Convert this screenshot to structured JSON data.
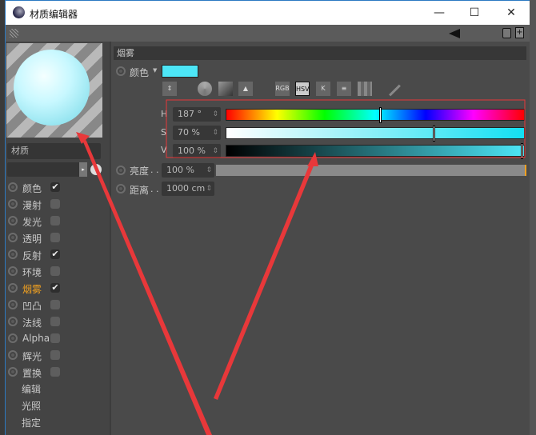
{
  "window": {
    "title": "材质编辑器",
    "minimize": "—",
    "maximize": "☐",
    "close": "✕"
  },
  "left": {
    "material_name_label": "材质",
    "channels": [
      {
        "label": "颜色",
        "checked": true
      },
      {
        "label": "漫射",
        "checked": false
      },
      {
        "label": "发光",
        "checked": false
      },
      {
        "label": "透明",
        "checked": false
      },
      {
        "label": "反射",
        "checked": true
      },
      {
        "label": "环境",
        "checked": false
      },
      {
        "label": "烟雾",
        "checked": true,
        "active": true
      },
      {
        "label": "凹凸",
        "checked": false
      },
      {
        "label": "法线",
        "checked": false
      },
      {
        "label": "Alpha",
        "checked": false
      },
      {
        "label": "辉光",
        "checked": false
      },
      {
        "label": "置换",
        "checked": false
      }
    ],
    "extras": [
      "编辑",
      "光照",
      "指定"
    ]
  },
  "fog": {
    "section_title": "烟雾",
    "color_label": "颜色",
    "color_swatch": "#4de6f7",
    "mode_buttons": [
      "RGB",
      "HSV",
      "K"
    ],
    "active_mode": "HSV",
    "h": {
      "label": "H",
      "value": "187 °",
      "level": 0.52
    },
    "s": {
      "label": "S",
      "value": "70 %",
      "level": 0.7
    },
    "v": {
      "label": "V",
      "value": "100 %",
      "level": 1.0
    },
    "brightness": {
      "label": "亮度",
      "dots": ". .",
      "value": "100 %",
      "level": 1.0
    },
    "distance": {
      "label": "距离",
      "dots": ". .",
      "value": "1000 cm"
    }
  },
  "colors": {
    "accent": "#f0a020",
    "annotation": "#e8383a"
  }
}
